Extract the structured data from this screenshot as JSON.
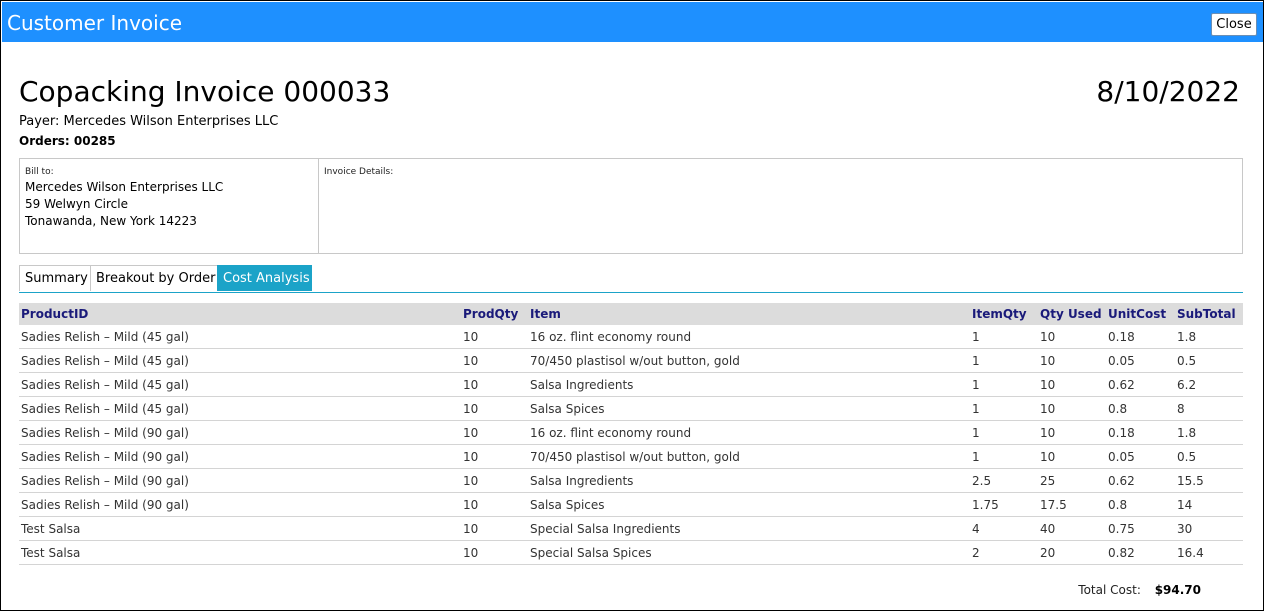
{
  "window": {
    "title": "Customer Invoice",
    "close_label": "Close"
  },
  "invoice": {
    "title": "Copacking Invoice 000033",
    "date": "8/10/2022",
    "payer": "Payer: Mercedes Wilson Enterprises LLC",
    "orders": "Orders: 00285"
  },
  "bill_to": {
    "label": "Bill to:",
    "lines": [
      "Mercedes Wilson Enterprises LLC",
      "59 Welwyn Circle",
      "Tonawanda, New York 14223"
    ]
  },
  "details": {
    "label": "Invoice Details:"
  },
  "tabs": [
    {
      "label": "Summary",
      "active": false
    },
    {
      "label": "Breakout by Order",
      "active": false
    },
    {
      "label": "Cost Analysis",
      "active": true
    }
  ],
  "table": {
    "headers": [
      "ProductID",
      "ProdQty",
      "Item",
      "ItemQty",
      "Qty Used",
      "UnitCost",
      "SubTotal"
    ],
    "rows": [
      [
        "Sadies Relish – Mild (45 gal)",
        "10",
        "16 oz. flint economy round",
        "1",
        "10",
        "0.18",
        "1.8"
      ],
      [
        "Sadies Relish – Mild (45 gal)",
        "10",
        "70/450 plastisol w/out button, gold",
        "1",
        "10",
        "0.05",
        "0.5"
      ],
      [
        "Sadies Relish – Mild (45 gal)",
        "10",
        "Salsa Ingredients",
        "1",
        "10",
        "0.62",
        "6.2"
      ],
      [
        "Sadies Relish – Mild (45 gal)",
        "10",
        "Salsa Spices",
        "1",
        "10",
        "0.8",
        "8"
      ],
      [
        "Sadies Relish – Mild (90 gal)",
        "10",
        "16 oz. flint economy round",
        "1",
        "10",
        "0.18",
        "1.8"
      ],
      [
        "Sadies Relish – Mild (90 gal)",
        "10",
        "70/450 plastisol w/out button, gold",
        "1",
        "10",
        "0.05",
        "0.5"
      ],
      [
        "Sadies Relish – Mild (90 gal)",
        "10",
        "Salsa Ingredients",
        "2.5",
        "25",
        "0.62",
        "15.5"
      ],
      [
        "Sadies Relish – Mild (90 gal)",
        "10",
        "Salsa Spices",
        "1.75",
        "17.5",
        "0.8",
        "14"
      ],
      [
        "Test Salsa",
        "10",
        "Special Salsa Ingredients",
        "4",
        "40",
        "0.75",
        "30"
      ],
      [
        "Test Salsa",
        "10",
        "Special Salsa Spices",
        "2",
        "20",
        "0.82",
        "16.4"
      ]
    ]
  },
  "total": {
    "label": "Total Cost:",
    "value": "$94.70"
  },
  "colors": {
    "titlebar": "#1e90ff",
    "active_tab": "#1ba3c8",
    "header_text": "#1a1a7a"
  }
}
